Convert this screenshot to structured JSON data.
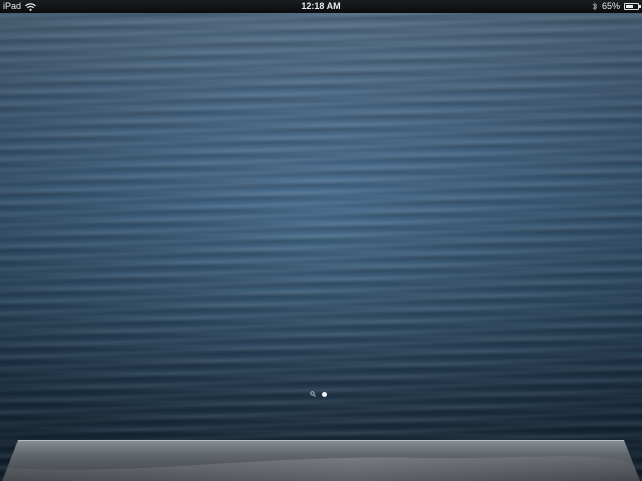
{
  "status_bar": {
    "carrier": "iPad",
    "time": "12:18 AM",
    "battery_percent": "65%",
    "battery_level": 0.65
  },
  "icons": {
    "wifi": "wifi-icon",
    "bluetooth": "bluetooth-icon",
    "battery": "battery-icon",
    "spotlight": "search-icon"
  },
  "home_screen": {
    "page_count": 1,
    "current_page": 1
  },
  "colors": {
    "status_bar_bg": "#111315",
    "wallpaper_top": "#5f7f9c",
    "wallpaper_bottom": "#142636"
  }
}
